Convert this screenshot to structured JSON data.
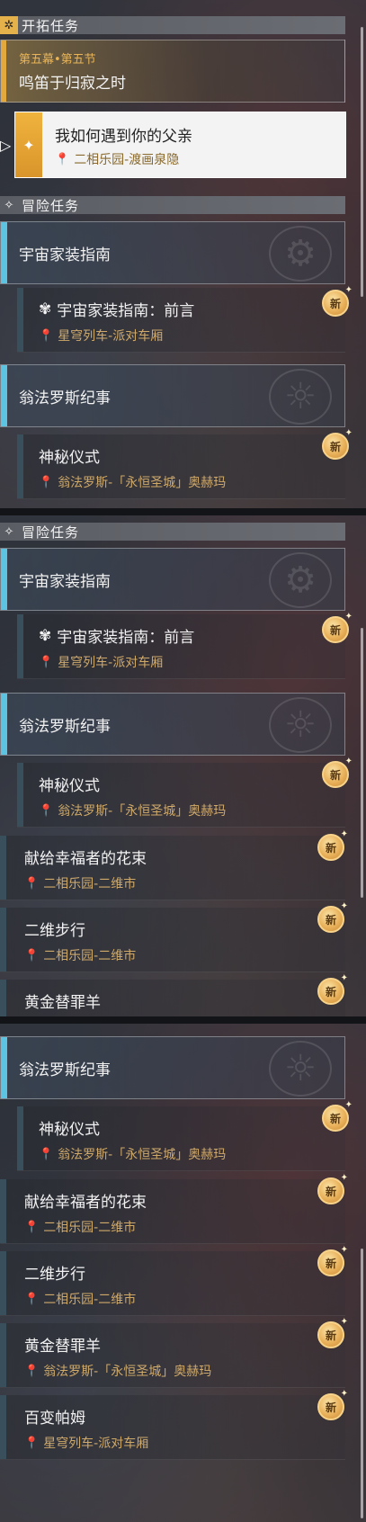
{
  "sections": {
    "trailblaze": "开拓任务",
    "adventure": "冒险任务"
  },
  "main_quest": {
    "chapter": "第五幕•第五节",
    "title": "鸣笛于归寂之时",
    "sub_title": "我如何遇到你的父亲",
    "sub_location": "二相乐园-渡画泉隐"
  },
  "groups": {
    "home_guide": "宇宙家装指南",
    "okhema": "翁法罗斯纪事"
  },
  "quests": {
    "preface": {
      "title": "宇宙家装指南：前言",
      "location": "星穹列车-派对车厢"
    },
    "ritual": {
      "title": "神秘仪式",
      "location": "翁法罗斯-「永恒圣城」奥赫玛"
    },
    "bouquet": {
      "title": "献给幸福者的花束",
      "location": "二相乐园-二维市"
    },
    "walk": {
      "title": "二维步行",
      "location": "二相乐园-二维市"
    },
    "scapegoat": {
      "title": "黄金替罪羊",
      "location": "翁法罗斯-「永恒圣城」奥赫玛"
    },
    "pom": {
      "title": "百变帕姆",
      "location": "星穹列车-派对车厢"
    }
  },
  "badge": "新",
  "icons": {
    "trailblaze_header": "gold-diamond-icon",
    "adventure_header": "star-diamond-icon",
    "location": "location-pin-icon",
    "preface_quest": "home-guide-icon",
    "selected_pointer": "pointer-arrow-icon"
  },
  "colors": {
    "gold": "#e3a93c",
    "blue_accent": "#5cc3e0",
    "location_text": "#cfa96a"
  }
}
